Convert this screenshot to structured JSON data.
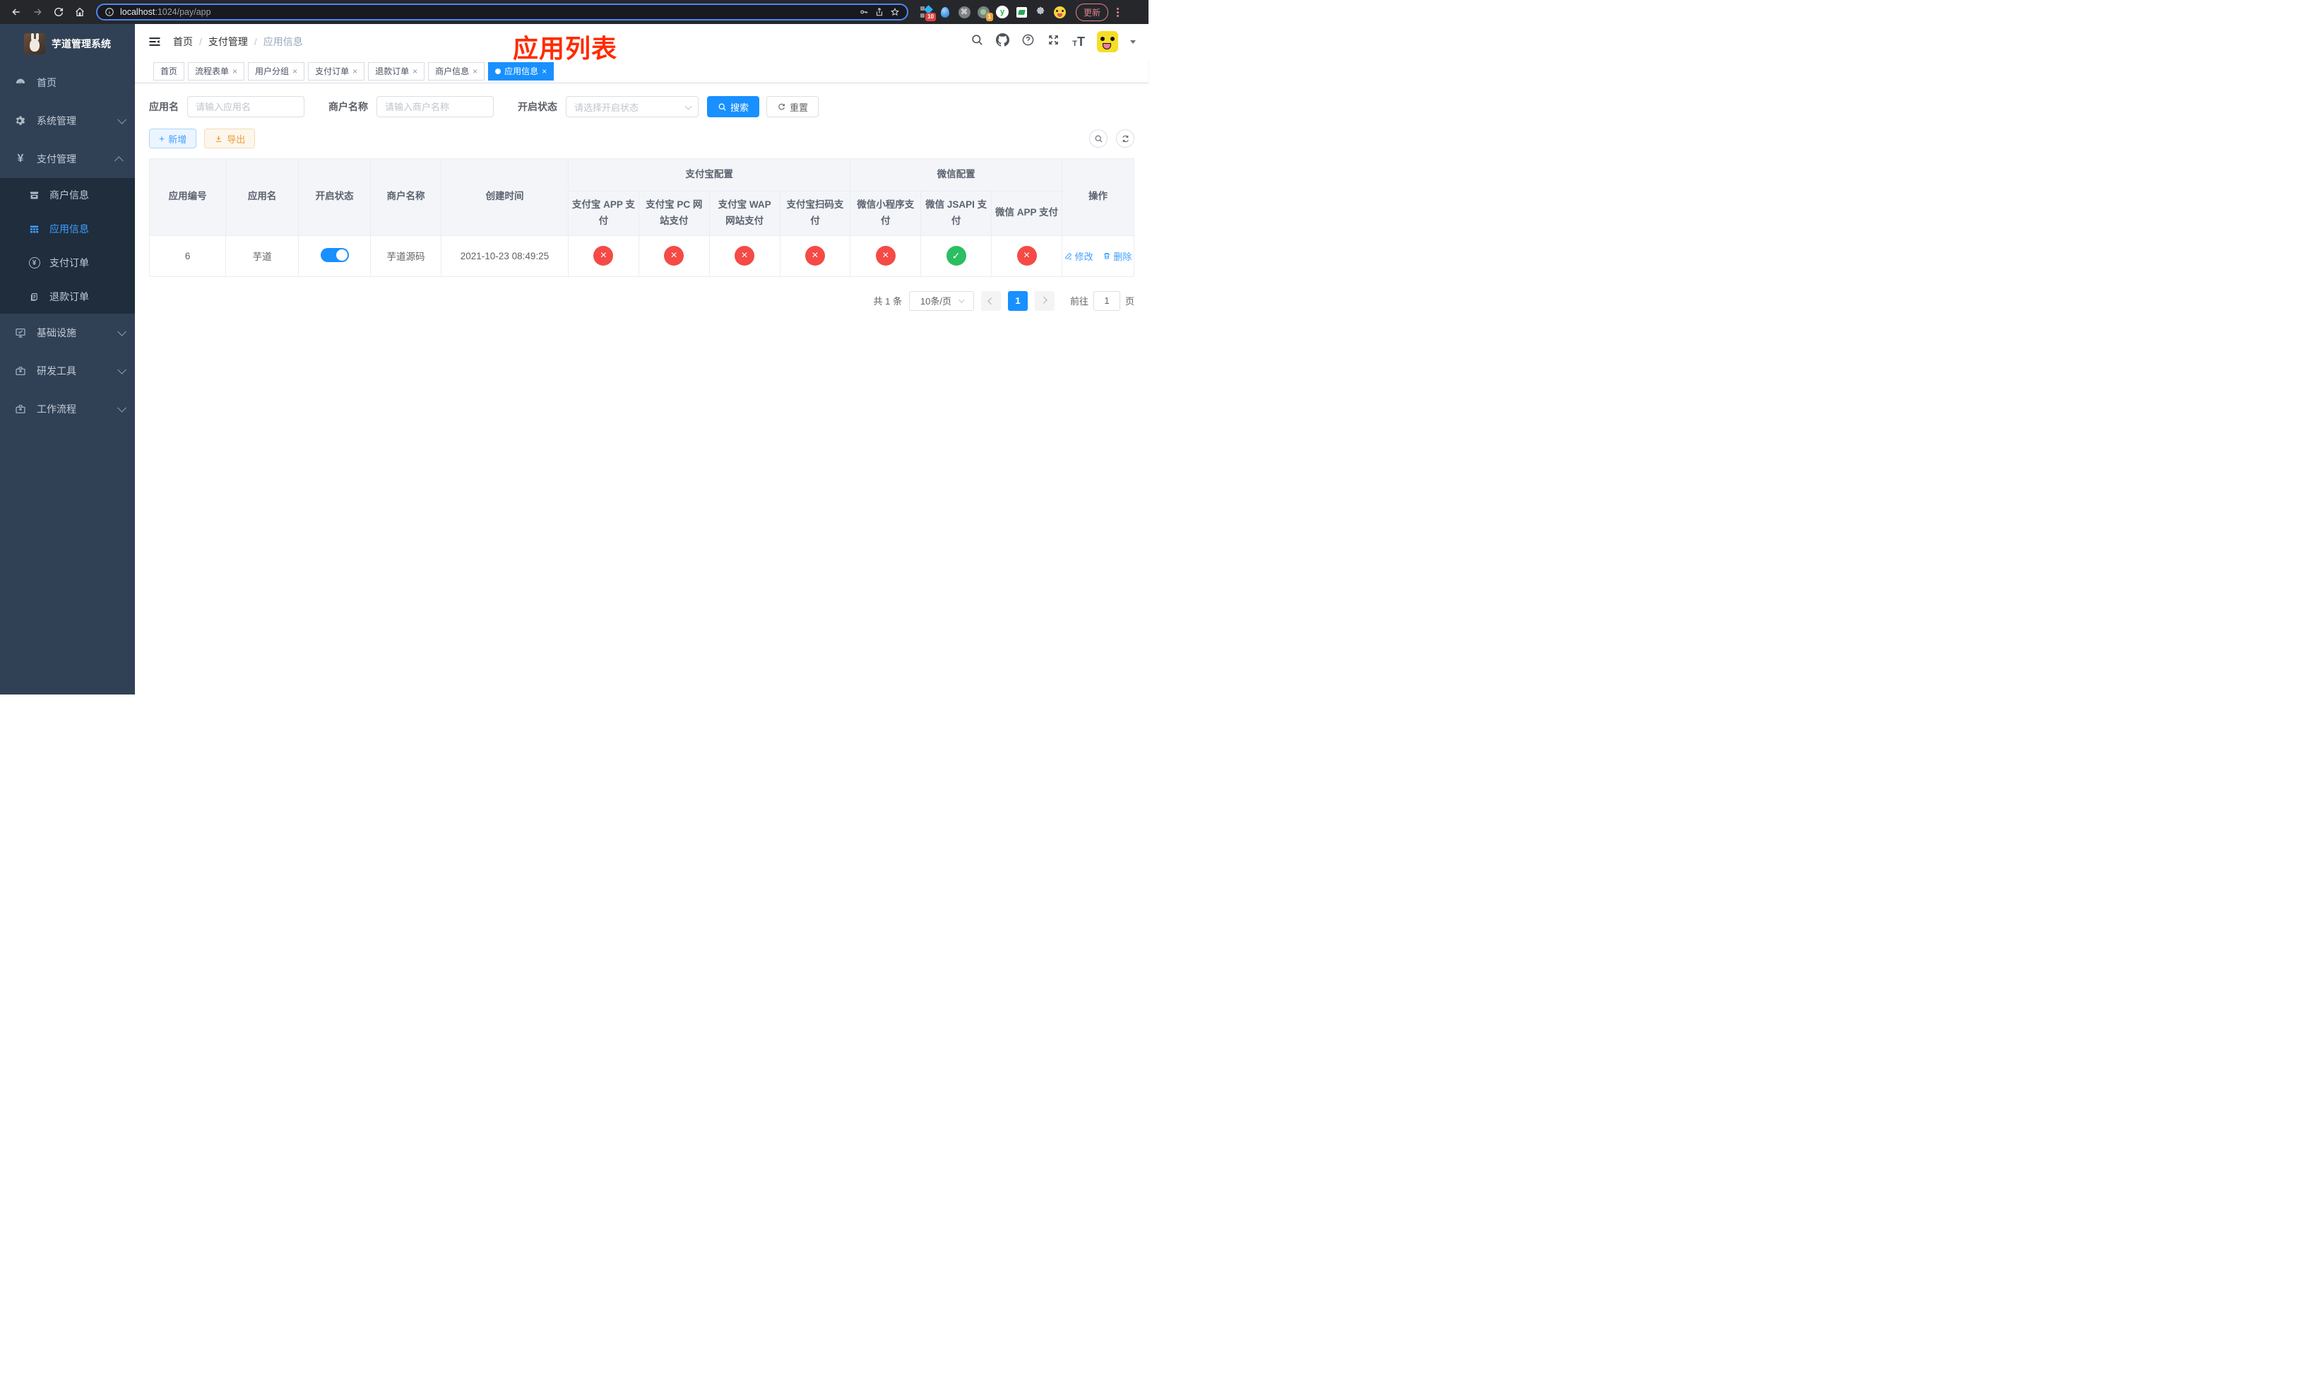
{
  "colors": {
    "primary": "#1890ff",
    "link_blue": "#409eff",
    "danger_red": "#f54a45",
    "success_green": "#2abf62",
    "export_orange": "#e6a23c",
    "annotation_red": "#ff2b00",
    "sidebar_bg": "#304156",
    "submenu_bg": "#1f2d3d"
  },
  "browser": {
    "url": {
      "host": "localhost",
      "path": ":1024/pay/app"
    },
    "update_button": "更新",
    "extensions": {
      "blue_diamond_badge": "10",
      "green_dot_badge": "1",
      "yudao_letter": "y",
      "command_glyph": "⌘"
    }
  },
  "sidebar": {
    "title": "芋道管理系统",
    "menu": [
      {
        "label": "首页",
        "icon": "dashboard-icon"
      },
      {
        "label": "系统管理",
        "icon": "gear-icon",
        "expandable": true
      },
      {
        "label": "支付管理",
        "icon": "yen-icon",
        "expandable": true,
        "expanded": true
      },
      {
        "label": "商户信息",
        "icon": "shop-icon",
        "submenu_of": "支付管理"
      },
      {
        "label": "应用信息",
        "icon": "grid-icon",
        "submenu_of": "支付管理",
        "active": true
      },
      {
        "label": "支付订单",
        "icon": "yen-circle-icon",
        "submenu_of": "支付管理"
      },
      {
        "label": "退款订单",
        "icon": "document-icon",
        "submenu_of": "支付管理"
      },
      {
        "label": "基础设施",
        "icon": "monitor-icon",
        "expandable": true
      },
      {
        "label": "研发工具",
        "icon": "toolbox-icon",
        "expandable": true
      },
      {
        "label": "工作流程",
        "icon": "toolbox-icon",
        "expandable": true
      }
    ]
  },
  "navbar": {
    "breadcrumb": {
      "home": "首页",
      "sep1": "/",
      "section": "支付管理",
      "sep2": "/",
      "current": "应用信息"
    },
    "annotation": "应用列表"
  },
  "tabs": [
    {
      "label": "首页",
      "closable": false,
      "active": false
    },
    {
      "label": "流程表单",
      "closable": true,
      "active": false
    },
    {
      "label": "用户分组",
      "closable": true,
      "active": false
    },
    {
      "label": "支付订单",
      "closable": true,
      "active": false
    },
    {
      "label": "退款订单",
      "closable": true,
      "active": false
    },
    {
      "label": "商户信息",
      "closable": true,
      "active": false
    },
    {
      "label": "应用信息",
      "closable": true,
      "active": true
    }
  ],
  "filters": {
    "app_name_label": "应用名",
    "app_name_placeholder": "请输入应用名",
    "merchant_label": "商户名称",
    "merchant_placeholder": "请输入商户名称",
    "status_label": "开启状态",
    "status_placeholder": "请选择开启状态",
    "search_button": "搜索",
    "reset_button": "重置"
  },
  "toolbar": {
    "add_button": "新增",
    "export_button": "导出"
  },
  "table": {
    "columns": {
      "app_id": "应用编号",
      "app_name": "应用名",
      "status": "开启状态",
      "merchant": "商户名称",
      "created": "创建时间",
      "alipay_group": "支付宝配置",
      "wechat_group": "微信配置",
      "alipay_app": "支付宝 APP 支付",
      "alipay_pc": "支付宝 PC 网站支付",
      "alipay_wap": "支付宝 WAP 网站支付",
      "alipay_qr": "支付宝扫码支付",
      "wx_mini": "微信小程序支付",
      "wx_jsapi": "微信 JSAPI 支付",
      "wx_app": "微信 APP 支付",
      "actions": "操作"
    },
    "rows": [
      {
        "id": "6",
        "name": "芋道",
        "enabled": true,
        "merchant": "芋道源码",
        "created": "2021-10-23 08:49:25",
        "alipay_app": false,
        "alipay_pc": false,
        "alipay_wap": false,
        "alipay_qr": false,
        "wx_mini": false,
        "wx_jsapi": true,
        "wx_app": false,
        "edit_label": "修改",
        "delete_label": "删除"
      }
    ]
  },
  "pagination": {
    "total_text": "共 1 条",
    "page_size": "10条/页",
    "current_page": "1",
    "goto_label": "前往",
    "goto_value": "1",
    "goto_suffix": "页"
  }
}
